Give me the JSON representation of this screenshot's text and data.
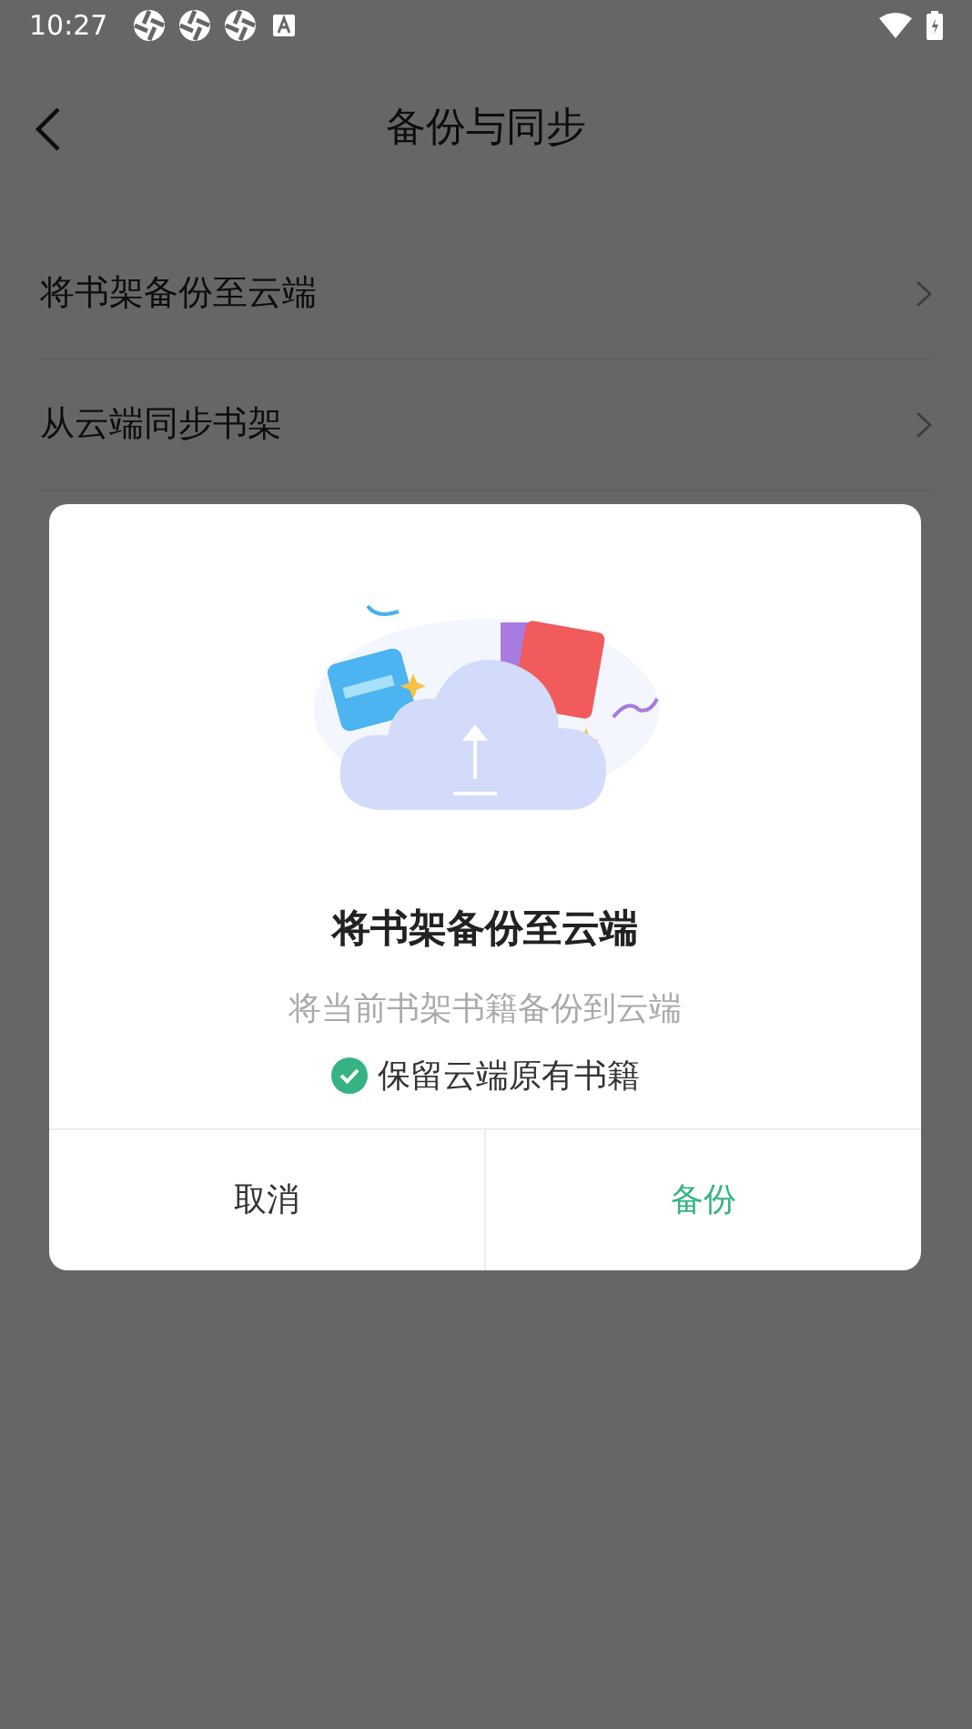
{
  "status_bar": {
    "time": "10:27"
  },
  "header": {
    "title": "备份与同步"
  },
  "settings_rows": [
    {
      "label": "将书架备份至云端"
    },
    {
      "label": "从云端同步书架"
    }
  ],
  "dialog": {
    "title": "将书架备份至云端",
    "description": "将当前书架书籍备份到云端",
    "option": {
      "label": "保留云端原有书籍",
      "checked": true
    },
    "buttons": [
      {
        "label": "取消",
        "kind": "cancel"
      },
      {
        "label": "备份",
        "kind": "confirm"
      }
    ]
  }
}
